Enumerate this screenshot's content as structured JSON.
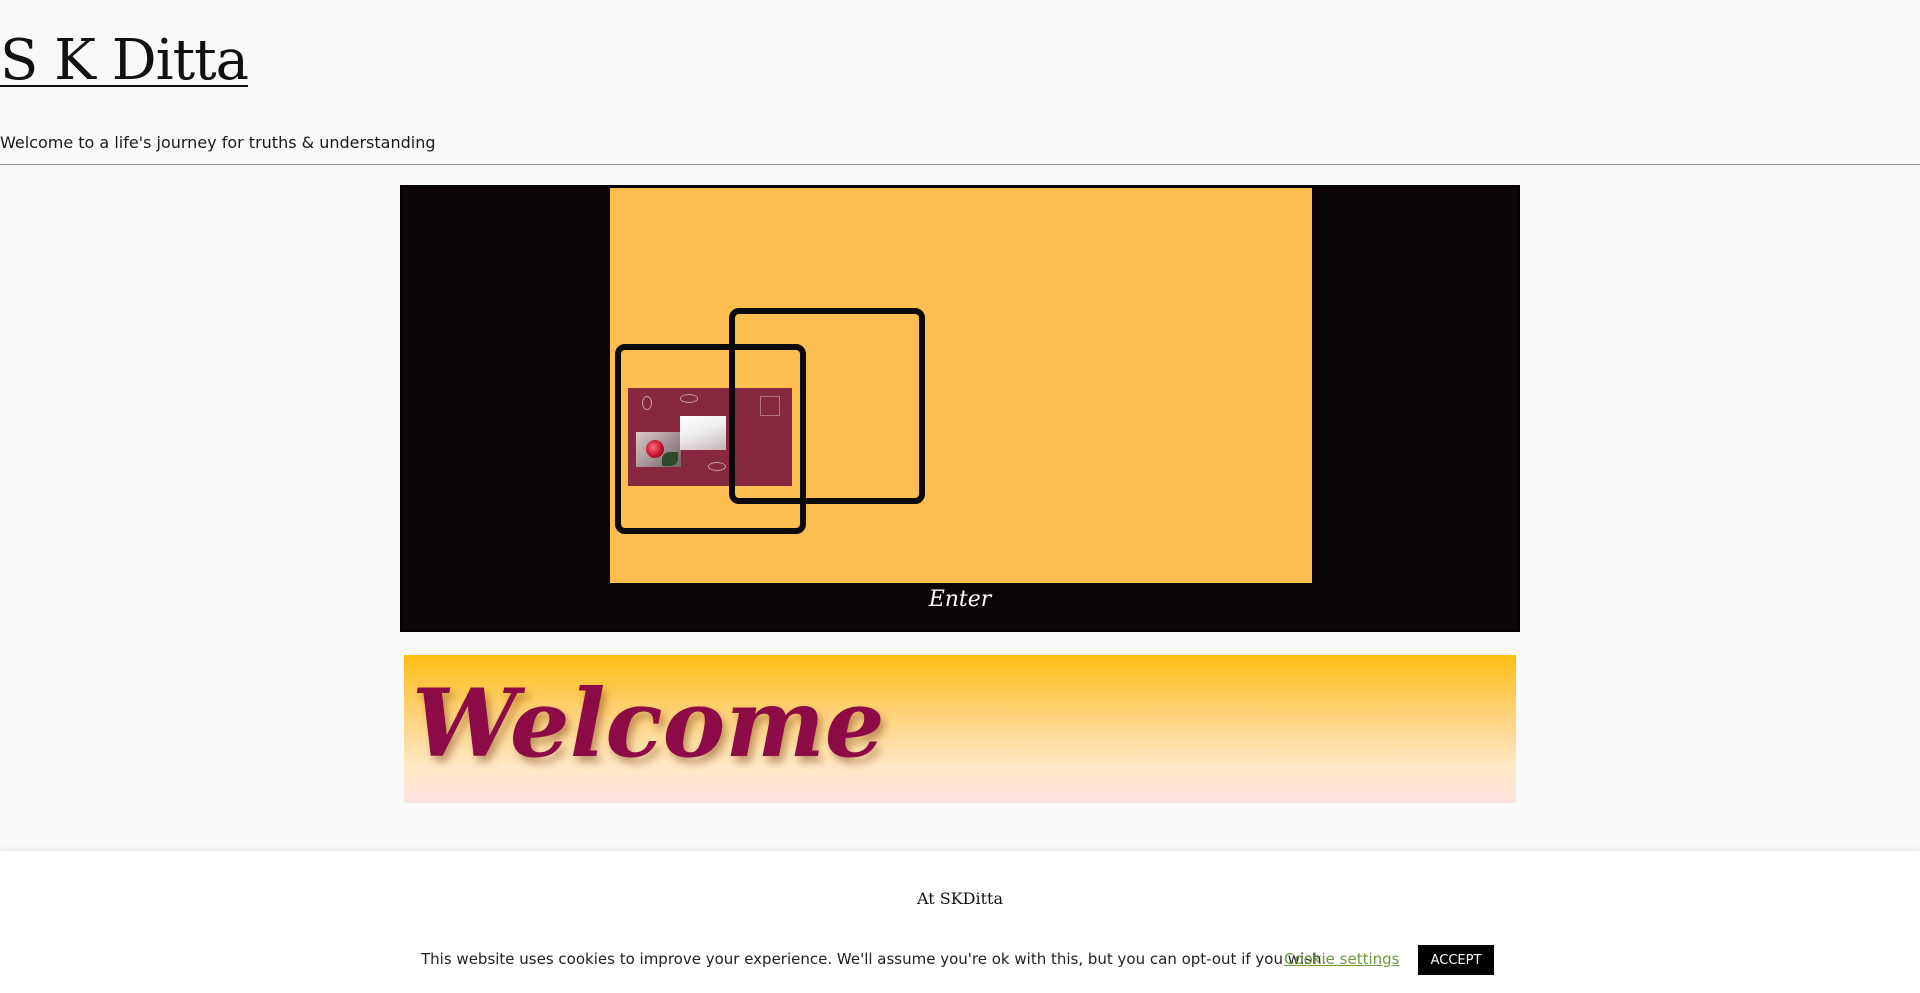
{
  "header": {
    "site_title": "S K Ditta",
    "tagline": "Welcome to a life's journey for truths & understanding"
  },
  "hero": {
    "enter_label": "Enter",
    "background_color": "#fdbd4f",
    "frame_color": "#0b0605"
  },
  "banner": {
    "welcome_text": "Welcome",
    "text_color": "#8c0b47"
  },
  "cookie_notice": {
    "heading": "At SKDitta",
    "message": "This website uses cookies to improve your experience. We'll assume you're ok with this, but you can opt-out if you wish.",
    "settings_label": "Cookie settings",
    "accept_label": "ACCEPT",
    "settings_color": "#6b9a3a"
  }
}
